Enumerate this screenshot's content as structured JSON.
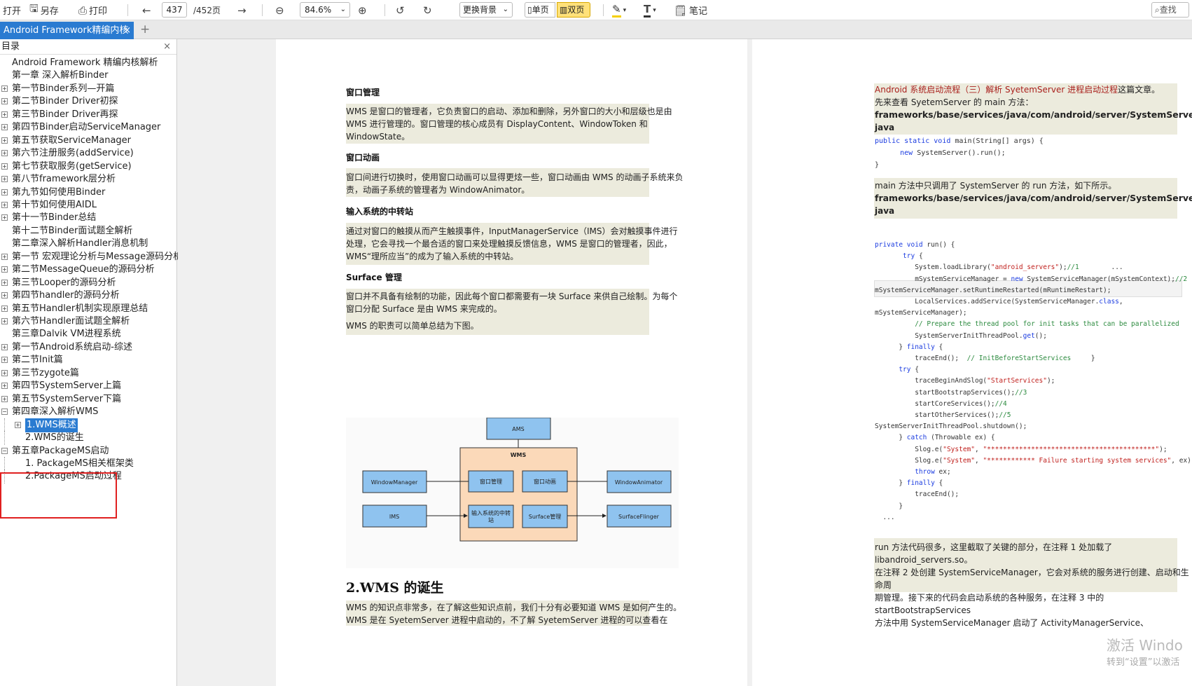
{
  "toolbar": {
    "open": "打开",
    "save_as": "另存",
    "print": "打印",
    "current_page": "437",
    "total_pages": "/452页",
    "zoom": "84.6%",
    "background": "更换背景",
    "single": "单页",
    "double": "双页",
    "notes": "笔记",
    "search": "查找"
  },
  "tabs": {
    "active": "Android Framework精编内核",
    "close": "×",
    "new_tab": "+"
  },
  "sidebar": {
    "title": "目录",
    "close": "×",
    "items": [
      {
        "label": "Android Framework 精编内核解析",
        "level": 0,
        "expand": false
      },
      {
        "label": "第一章 深入解析Binder",
        "level": 0,
        "expand": false
      },
      {
        "label": "第一节Binder系列—开篇",
        "level": 0,
        "expand": true
      },
      {
        "label": "第二节Binder Driver初探",
        "level": 0,
        "expand": true
      },
      {
        "label": "第三节Binder Driver再探",
        "level": 0,
        "expand": true
      },
      {
        "label": "第四节Binder启动ServiceManager",
        "level": 0,
        "expand": true
      },
      {
        "label": "第五节获取ServiceManager",
        "level": 0,
        "expand": true
      },
      {
        "label": "第六节注册服务(addService)",
        "level": 0,
        "expand": true
      },
      {
        "label": "第七节获取服务(getService)",
        "level": 0,
        "expand": true
      },
      {
        "label": "第八节framework层分析",
        "level": 0,
        "expand": true
      },
      {
        "label": "第九节如何使用Binder",
        "level": 0,
        "expand": true
      },
      {
        "label": "第十节如何使用AIDL",
        "level": 0,
        "expand": true
      },
      {
        "label": "第十一节Binder总结",
        "level": 0,
        "expand": true
      },
      {
        "label": "第十二节Binder面试题全解析",
        "level": 0,
        "expand": false
      },
      {
        "label": "第二章深入解析Handler消息机制",
        "level": 0,
        "expand": false
      },
      {
        "label": "第一节 宏观理论分析与Message源码分析",
        "level": 0,
        "expand": true
      },
      {
        "label": "第二节MessageQueue的源码分析",
        "level": 0,
        "expand": true
      },
      {
        "label": "第三节Looper的源码分析",
        "level": 0,
        "expand": true
      },
      {
        "label": "第四节handler的源码分析",
        "level": 0,
        "expand": true
      },
      {
        "label": "第五节Handler机制实现原理总结",
        "level": 0,
        "expand": true
      },
      {
        "label": "第六节Handler面试题全解析",
        "level": 0,
        "expand": true
      },
      {
        "label": "第三章Dalvik VM进程系统",
        "level": 0,
        "expand": false
      },
      {
        "label": "第一节Android系统启动-综述",
        "level": 0,
        "expand": true
      },
      {
        "label": "第二节Init篇",
        "level": 0,
        "expand": true
      },
      {
        "label": "第三节zygote篇",
        "level": 0,
        "expand": true
      },
      {
        "label": "第四节SystemServer上篇",
        "level": 0,
        "expand": true
      },
      {
        "label": "第五节SystemServer下篇",
        "level": 0,
        "expand": true
      },
      {
        "label": "第四章深入解析WMS",
        "level": 0,
        "expand": false,
        "open": true
      },
      {
        "label": "1.WMS概述",
        "level": 1,
        "expand": true,
        "selected": true
      },
      {
        "label": "2.WMS的诞生",
        "level": 1,
        "expand": false
      },
      {
        "label": "第五章PackageMS启动",
        "level": 0,
        "expand": false,
        "open": true
      },
      {
        "label": "1. PackageMS相关框架类",
        "level": 1,
        "expand": false
      },
      {
        "label": "2.PackageMS启动过程",
        "level": 1,
        "expand": false
      }
    ]
  },
  "left_page": {
    "h_window_manage": "窗口管理",
    "p_window_manage": [
      "WMS 是窗口的管理者，它负责窗口的启动、添加和删除，另外窗口的大小和层级也是由",
      "WMS 进行管理的。窗口管理的核心成员有 DisplayContent、WindowToken 和",
      "WindowState。"
    ],
    "h_window_anim": "窗口动画",
    "p_window_anim": [
      "窗口间进行切换时，使用窗口动画可以显得更炫一些，窗口动画由 WMS 的动画子系统来负",
      "责，动画子系统的管理者为 WindowAnimator。"
    ],
    "h_input": "输入系统的中转站",
    "p_input": [
      "通过对窗口的触摸从而产生触摸事件，InputManagerService（IMS）会对触摸事件进行",
      "处理，它会寻找一个最合适的窗口来处理触摸反馈信息，WMS 是窗口的管理者，因此，",
      "WMS“理所应当”的成为了输入系统的中转站。"
    ],
    "h_surface": "Surface 管理",
    "p_surface": [
      "窗口并不具备有绘制的功能，因此每个窗口都需要有一块 Surface 来供自己绘制。为每个",
      "窗口分配 Surface 是由 WMS 来完成的。"
    ],
    "p_summary": "WMS 的职责可以简单总结为下图。",
    "diagram": {
      "ams": "AMS",
      "wms": "WMS",
      "window_manage": "窗口管理",
      "window_anim": "窗口动画",
      "input_relay_1": "输入系统的中转",
      "input_relay_2": "站",
      "surface_manage": "Surface管理",
      "window_manager": "WindowManager",
      "window_animator": "WindowAnimator",
      "ims": "IMS",
      "surface_flinger": "SurfaceFlinger"
    },
    "sec2_title": "2.WMS 的诞生",
    "p_sec2": [
      "WMS 的知识点非常多，在了解这些知识点前，我们十分有必要知道 WMS 是如何产生的。",
      "WMS 是在 SyetemServer 进程中启动的，不了解 SyetemServer 进程的可以查看在"
    ]
  },
  "right_page": {
    "link_line": "Android 系统启动流程（三）解析 SyetemServer 进程启动过程",
    "link_suffix": "这篇文章。",
    "main_intro": "先来查看 SyetemServer 的 main 方法：",
    "path1a": "frameworks/base/services/java/com/android/server/SystemServer.",
    "path1b": "java",
    "run_intro": "main 方法中只调用了 SystemServer 的 run 方法，如下所示。",
    "path2a": "frameworks/base/services/java/com/android/server/SystemServer.",
    "path2b": "java",
    "bottom_para": [
      "run 方法代码很多，这里截取了关键的部分，在注释 1 处加载了 libandroid_servers.so。",
      "在注释 2 处创建 SystemServiceManager，它会对系统的服务进行创建、启动和生命周",
      "期管理。接下来的代码会启动系统的各种服务，在注释 3 中的 startBootstrapServices",
      "方法中用 SystemServiceManager 启动了 ActivityManagerService、"
    ]
  },
  "watermark": {
    "title": "激活 Windo",
    "sub": "转到“设置”以激活"
  }
}
